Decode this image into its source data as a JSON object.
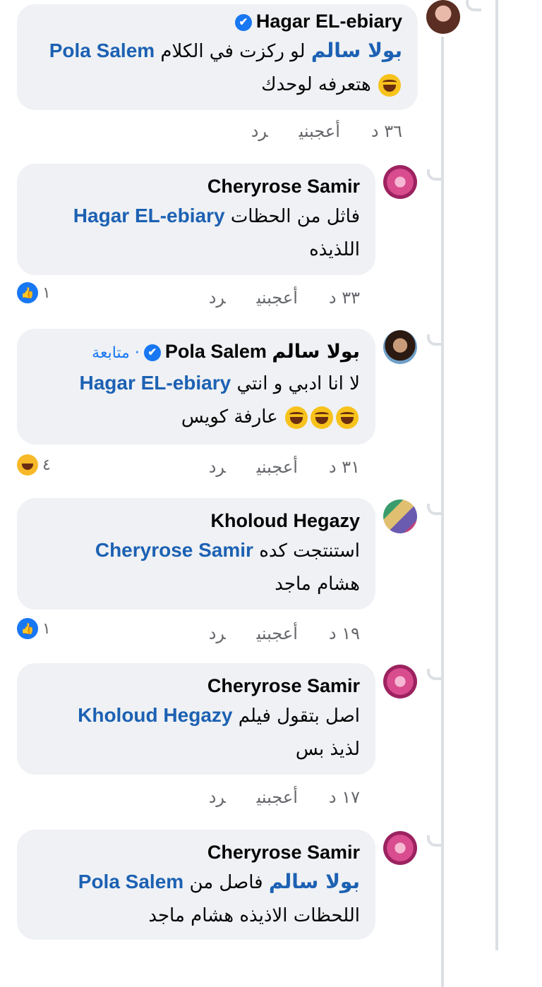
{
  "comments": [
    {
      "author": "Hagar EL-ebiary",
      "verified": true,
      "lines": [
        "بولا سالم",
        "Pola Salem",
        "لو ركزت في الكلام",
        "هتعرفه لوحدك"
      ],
      "time": "٣٦ د",
      "like": "أعجبني",
      "reply": "رد"
    },
    {
      "author": "Cheryrose Samir",
      "lines": [
        "Hagar EL-ebiary",
        "فاثل من الحظات",
        "اللذيذه"
      ],
      "time": "٣٣ د",
      "like": "أعجبني",
      "reply": "رد",
      "reaction_count": "١"
    },
    {
      "author_ar": "بولا سالم",
      "author": "Pola Salem",
      "verified": true,
      "follow": "· متابعة",
      "lines": [
        "Hagar EL-ebiary",
        "لا انا ادبي و انتي",
        "عارفة كويس"
      ],
      "time": "٣١ د",
      "like": "أعجبني",
      "reply": "رد",
      "reaction_count": "٤"
    },
    {
      "author": "Kholoud Hegazy",
      "lines": [
        "Cheryrose Samir",
        "استنتجت كده",
        "هشام ماجد"
      ],
      "time": "١٩ د",
      "like": "أعجبني",
      "reply": "رد",
      "reaction_count": "١"
    },
    {
      "author": "Cheryrose Samir",
      "lines": [
        "Kholoud Hegazy",
        "اصل بتقول فيلم",
        "لذيذ بس"
      ],
      "time": "١٧ د",
      "like": "أعجبني",
      "reply": "رد"
    },
    {
      "author": "Cheryrose Samir",
      "lines": [
        "بولا سالم",
        "Pola Salem",
        "فاصل من",
        "اللحظات الاذيذه هشام ماجد"
      ]
    }
  ],
  "icons": {
    "verified": "verified-badge-icon",
    "like": "like-reaction-icon",
    "haha": "haha-reaction-icon",
    "laugh": "laughing-emoji-icon"
  },
  "colors": {
    "bubble": "#eff1f4",
    "mention": "#1c61b3",
    "accent": "#1877f2",
    "meta": "#65676b"
  }
}
